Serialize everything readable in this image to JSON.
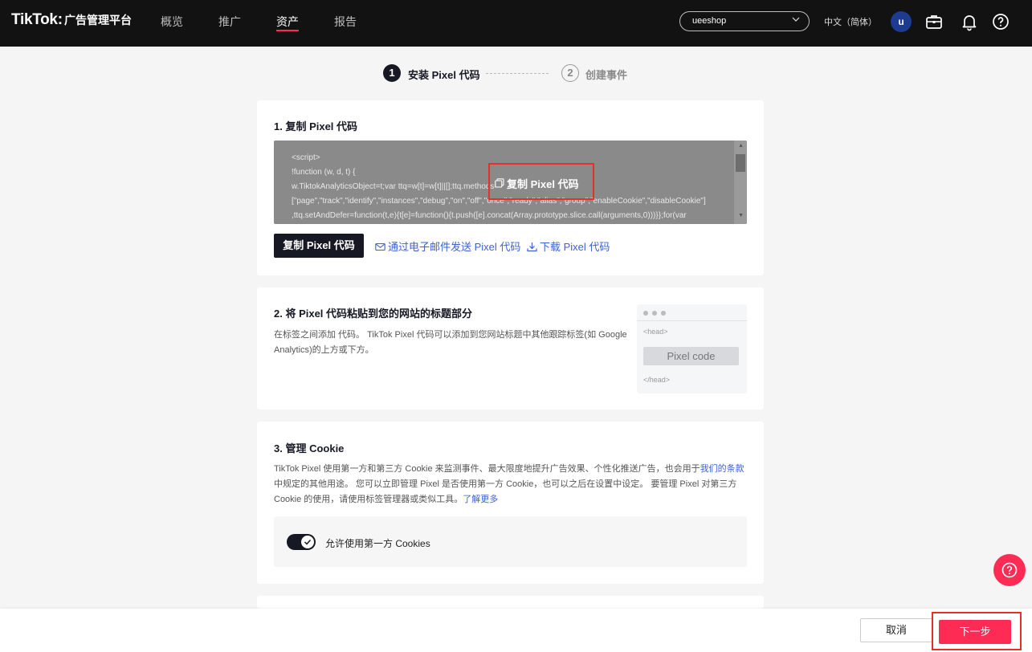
{
  "brand": {
    "logo": "TikTok",
    "separator": ":",
    "subtitle": "广告管理平台"
  },
  "nav": {
    "items": [
      "概览",
      "推广",
      "资产",
      "报告"
    ],
    "active": "资产"
  },
  "account": {
    "name": "ueeshop"
  },
  "language": "中文（简体）",
  "user": {
    "avatar_letter": "u"
  },
  "icons": {
    "account_chevron": "chevron-down-icon",
    "briefcase": "briefcase-icon",
    "bell": "bell-icon",
    "help": "help-icon",
    "copy": "copy-icon",
    "mail": "mail-icon",
    "download": "download-icon",
    "check": "check-icon"
  },
  "stepper": {
    "steps": [
      {
        "number": "1",
        "label": "安装 Pixel 代码",
        "state": "active"
      },
      {
        "number": "2",
        "label": "创建事件",
        "state": "inactive"
      }
    ]
  },
  "section1": {
    "title": "1. 复制 Pixel 代码",
    "code_lines": [
      "<script>",
      "!function (w, d, t) {",
      "  w.TiktokAnalyticsObject=t;var ttq=w[t]=w[t]||[];ttq.methods=",
      "[\"page\",\"track\",\"identify\",\"instances\",\"debug\",\"on\",\"off\",\"once\",\"ready\",\"alias\",\"group\",\"enableCookie\",\"disableCookie\"]",
      ",ttq.setAndDefer=function(t,e){t[e]=function(){t.push([e].concat(Array.prototype.slice.call(arguments,0)))}};for(var"
    ],
    "overlay_copy_label": "复制 Pixel 代码",
    "copy_button": "复制 Pixel 代码",
    "email_link": "通过电子邮件发送 Pixel 代码",
    "download_link": "下载 Pixel 代码"
  },
  "section2": {
    "title": "2. 将 Pixel 代码粘贴到您的网站的标题部分",
    "description": "在标签之间添加 代码。 TikTok Pixel 代码可以添加到您网站标题中其他跟踪标签(如 Google Analytics)的上方或下方。",
    "mock": {
      "head_open": "<head>",
      "code_label": "Pixel code",
      "head_close": "</head>"
    }
  },
  "section3": {
    "title": "3. 管理 Cookie",
    "desc_part1": "TikTok Pixel 使用第一方和第三方 Cookie 来监测事件、最大限度地提升广告效果、个性化推送广告，也会用于",
    "terms_link": "我们的条款",
    "desc_part2": "中规定的其他用途。 您可以立即管理 Pixel 是否使用第一方 Cookie，也可以之后在设置中设定。 要管理 Pixel 对第三方 Cookie 的使用，请使用标签管理器或类似工具。",
    "learn_more_link": "了解更多",
    "toggle_label": "允许使用第一方 Cookies",
    "toggle_on": true
  },
  "footer": {
    "cancel": "取消",
    "next": "下一步"
  },
  "colors": {
    "accent": "#fe2c55",
    "link": "#3e61d6",
    "dark": "#161823",
    "highlight_border": "#e8302b"
  }
}
